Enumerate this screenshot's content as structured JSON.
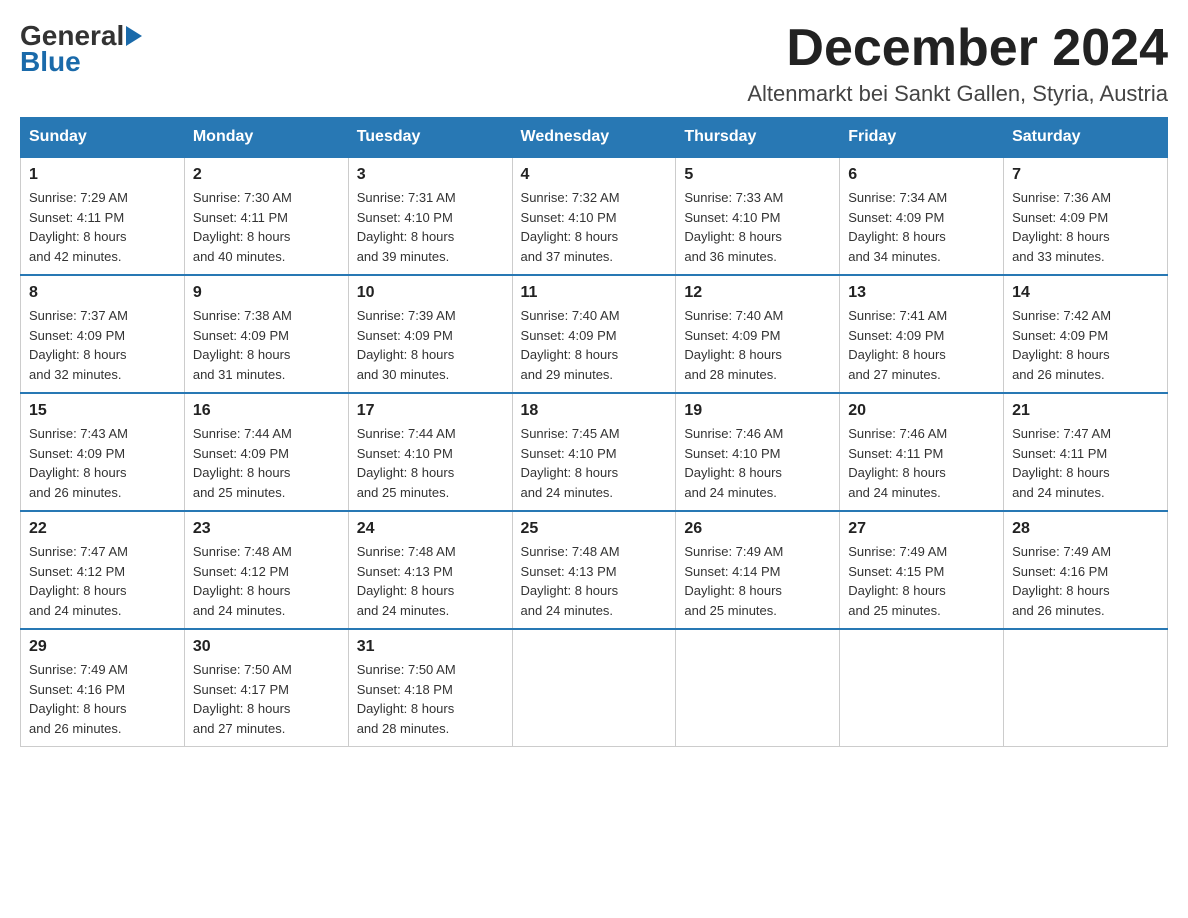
{
  "header": {
    "logo_general": "General",
    "logo_blue": "Blue",
    "month_title": "December 2024",
    "location": "Altenmarkt bei Sankt Gallen, Styria, Austria"
  },
  "weekdays": [
    "Sunday",
    "Monday",
    "Tuesday",
    "Wednesday",
    "Thursday",
    "Friday",
    "Saturday"
  ],
  "weeks": [
    [
      {
        "day": "1",
        "sunrise": "7:29 AM",
        "sunset": "4:11 PM",
        "daylight": "8 hours and 42 minutes."
      },
      {
        "day": "2",
        "sunrise": "7:30 AM",
        "sunset": "4:11 PM",
        "daylight": "8 hours and 40 minutes."
      },
      {
        "day": "3",
        "sunrise": "7:31 AM",
        "sunset": "4:10 PM",
        "daylight": "8 hours and 39 minutes."
      },
      {
        "day": "4",
        "sunrise": "7:32 AM",
        "sunset": "4:10 PM",
        "daylight": "8 hours and 37 minutes."
      },
      {
        "day": "5",
        "sunrise": "7:33 AM",
        "sunset": "4:10 PM",
        "daylight": "8 hours and 36 minutes."
      },
      {
        "day": "6",
        "sunrise": "7:34 AM",
        "sunset": "4:09 PM",
        "daylight": "8 hours and 34 minutes."
      },
      {
        "day": "7",
        "sunrise": "7:36 AM",
        "sunset": "4:09 PM",
        "daylight": "8 hours and 33 minutes."
      }
    ],
    [
      {
        "day": "8",
        "sunrise": "7:37 AM",
        "sunset": "4:09 PM",
        "daylight": "8 hours and 32 minutes."
      },
      {
        "day": "9",
        "sunrise": "7:38 AM",
        "sunset": "4:09 PM",
        "daylight": "8 hours and 31 minutes."
      },
      {
        "day": "10",
        "sunrise": "7:39 AM",
        "sunset": "4:09 PM",
        "daylight": "8 hours and 30 minutes."
      },
      {
        "day": "11",
        "sunrise": "7:40 AM",
        "sunset": "4:09 PM",
        "daylight": "8 hours and 29 minutes."
      },
      {
        "day": "12",
        "sunrise": "7:40 AM",
        "sunset": "4:09 PM",
        "daylight": "8 hours and 28 minutes."
      },
      {
        "day": "13",
        "sunrise": "7:41 AM",
        "sunset": "4:09 PM",
        "daylight": "8 hours and 27 minutes."
      },
      {
        "day": "14",
        "sunrise": "7:42 AM",
        "sunset": "4:09 PM",
        "daylight": "8 hours and 26 minutes."
      }
    ],
    [
      {
        "day": "15",
        "sunrise": "7:43 AM",
        "sunset": "4:09 PM",
        "daylight": "8 hours and 26 minutes."
      },
      {
        "day": "16",
        "sunrise": "7:44 AM",
        "sunset": "4:09 PM",
        "daylight": "8 hours and 25 minutes."
      },
      {
        "day": "17",
        "sunrise": "7:44 AM",
        "sunset": "4:10 PM",
        "daylight": "8 hours and 25 minutes."
      },
      {
        "day": "18",
        "sunrise": "7:45 AM",
        "sunset": "4:10 PM",
        "daylight": "8 hours and 24 minutes."
      },
      {
        "day": "19",
        "sunrise": "7:46 AM",
        "sunset": "4:10 PM",
        "daylight": "8 hours and 24 minutes."
      },
      {
        "day": "20",
        "sunrise": "7:46 AM",
        "sunset": "4:11 PM",
        "daylight": "8 hours and 24 minutes."
      },
      {
        "day": "21",
        "sunrise": "7:47 AM",
        "sunset": "4:11 PM",
        "daylight": "8 hours and 24 minutes."
      }
    ],
    [
      {
        "day": "22",
        "sunrise": "7:47 AM",
        "sunset": "4:12 PM",
        "daylight": "8 hours and 24 minutes."
      },
      {
        "day": "23",
        "sunrise": "7:48 AM",
        "sunset": "4:12 PM",
        "daylight": "8 hours and 24 minutes."
      },
      {
        "day": "24",
        "sunrise": "7:48 AM",
        "sunset": "4:13 PM",
        "daylight": "8 hours and 24 minutes."
      },
      {
        "day": "25",
        "sunrise": "7:48 AM",
        "sunset": "4:13 PM",
        "daylight": "8 hours and 24 minutes."
      },
      {
        "day": "26",
        "sunrise": "7:49 AM",
        "sunset": "4:14 PM",
        "daylight": "8 hours and 25 minutes."
      },
      {
        "day": "27",
        "sunrise": "7:49 AM",
        "sunset": "4:15 PM",
        "daylight": "8 hours and 25 minutes."
      },
      {
        "day": "28",
        "sunrise": "7:49 AM",
        "sunset": "4:16 PM",
        "daylight": "8 hours and 26 minutes."
      }
    ],
    [
      {
        "day": "29",
        "sunrise": "7:49 AM",
        "sunset": "4:16 PM",
        "daylight": "8 hours and 26 minutes."
      },
      {
        "day": "30",
        "sunrise": "7:50 AM",
        "sunset": "4:17 PM",
        "daylight": "8 hours and 27 minutes."
      },
      {
        "day": "31",
        "sunrise": "7:50 AM",
        "sunset": "4:18 PM",
        "daylight": "8 hours and 28 minutes."
      },
      null,
      null,
      null,
      null
    ]
  ]
}
